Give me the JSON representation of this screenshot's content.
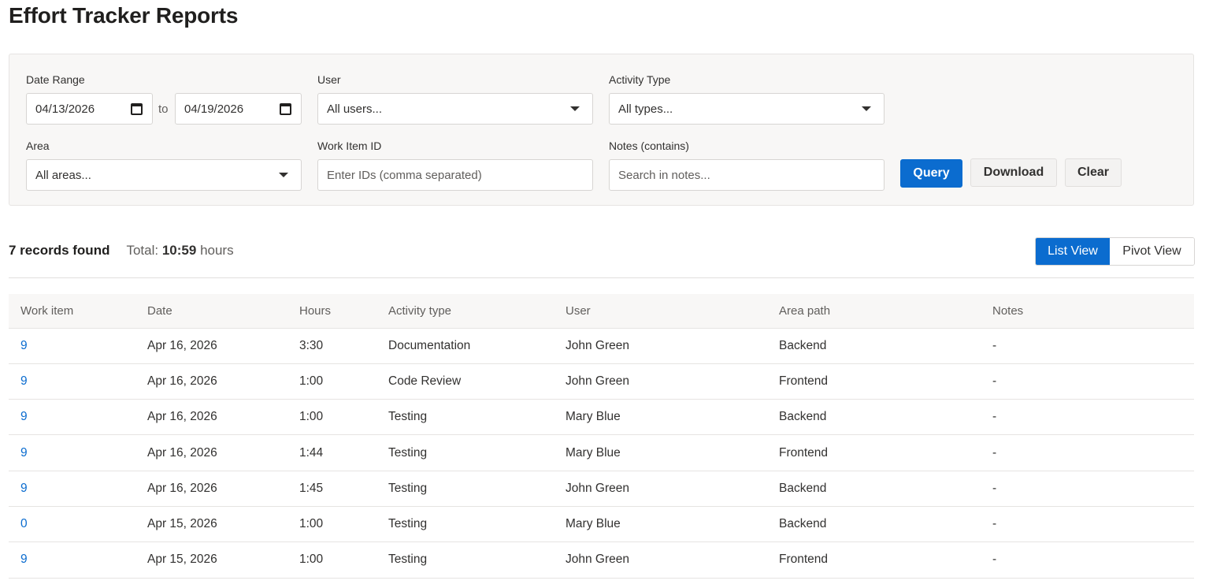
{
  "page": {
    "title": "Effort Tracker Reports"
  },
  "filters": {
    "date_range": {
      "label": "Date Range",
      "from": "04/13/2026",
      "separator": "to",
      "to": "04/19/2026"
    },
    "user": {
      "label": "User",
      "value": "All users..."
    },
    "activity_type": {
      "label": "Activity Type",
      "value": "All types..."
    },
    "area": {
      "label": "Area",
      "value": "All areas..."
    },
    "work_item_id": {
      "label": "Work Item ID",
      "placeholder": "Enter IDs (comma separated)"
    },
    "notes": {
      "label": "Notes (contains)",
      "placeholder": "Search in notes..."
    }
  },
  "buttons": {
    "query": "Query",
    "download": "Download",
    "clear": "Clear"
  },
  "summary": {
    "records": "7 records found",
    "total_label": "Total:",
    "total_value": "10:59",
    "total_unit": "hours"
  },
  "view_toggle": {
    "list": "List View",
    "pivot": "Pivot View",
    "active": "list"
  },
  "table": {
    "columns": [
      "Work item",
      "Date",
      "Hours",
      "Activity type",
      "User",
      "Area path",
      "Notes"
    ],
    "rows": [
      [
        "9",
        "Apr 16, 2026",
        "3:30",
        "Documentation",
        "John Green",
        "Backend",
        "-"
      ],
      [
        "9",
        "Apr 16, 2026",
        "1:00",
        "Code Review",
        "John Green",
        "Frontend",
        "-"
      ],
      [
        "9",
        "Apr 16, 2026",
        "1:00",
        "Testing",
        "Mary Blue",
        "Backend",
        "-"
      ],
      [
        "9",
        "Apr 16, 2026",
        "1:44",
        "Testing",
        "Mary Blue",
        "Frontend",
        "-"
      ],
      [
        "9",
        "Apr 16, 2026",
        "1:45",
        "Testing",
        "John Green",
        "Backend",
        "-"
      ],
      [
        "0",
        "Apr 15, 2026",
        "1:00",
        "Testing",
        "Mary Blue",
        "Backend",
        "-"
      ],
      [
        "9",
        "Apr 15, 2026",
        "1:00",
        "Testing",
        "John Green",
        "Frontend",
        "-"
      ]
    ]
  },
  "colors": {
    "accent": "#0b6ccf",
    "panel_bg": "#f8f7f6",
    "border": "#d7d5d3"
  },
  "icons": {
    "date": "calendar-icon",
    "dropdown": "chevron-down-icon"
  }
}
